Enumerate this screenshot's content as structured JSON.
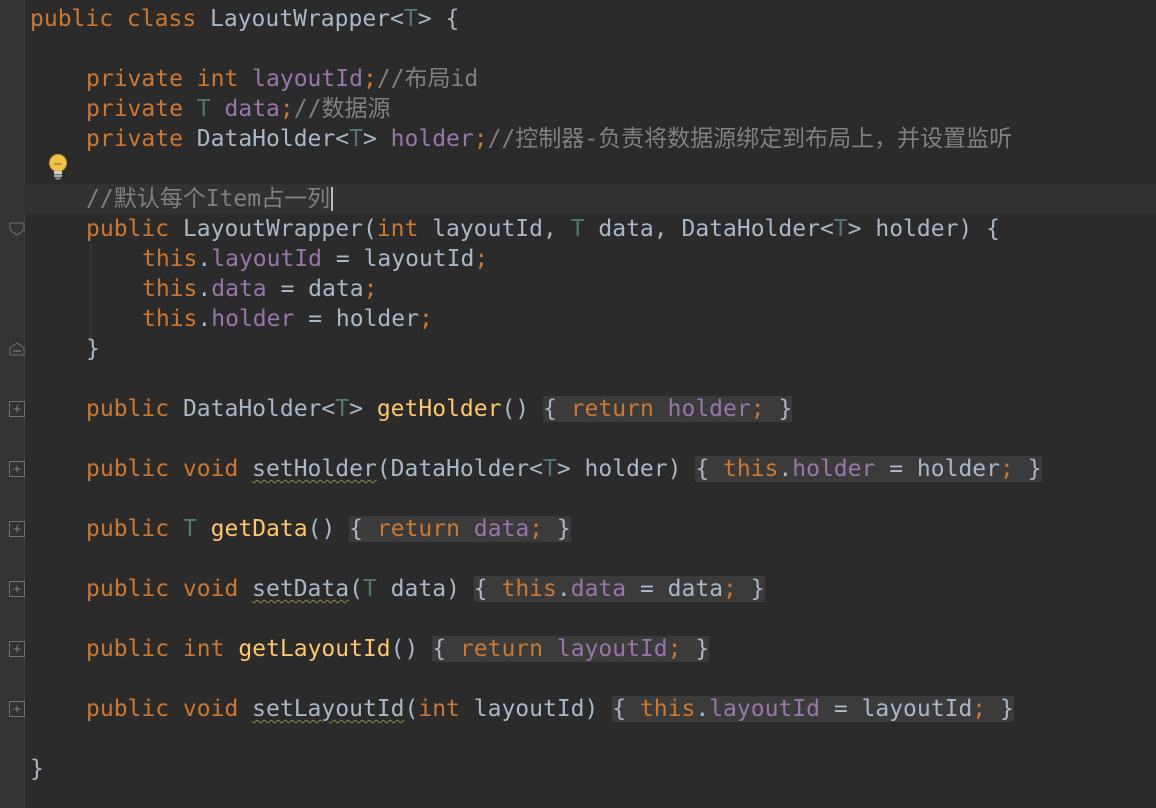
{
  "editor": {
    "theme_colors": {
      "background": "#2b2b2b",
      "keyword": "#cc7832",
      "field": "#9876aa",
      "type_param": "#507874",
      "method": "#ffc66d",
      "comment": "#808080",
      "text": "#a9b7c6"
    },
    "icons": {
      "intention_bulb": "lightbulb-icon",
      "fold_expand": "plus-box-icon",
      "fold_collapse": "minus-box-icon"
    }
  },
  "code": {
    "t": "T",
    "l1": {
      "kw": "public class ",
      "name": "LayoutWrapper<",
      "close": "> {"
    },
    "l2": {
      "kw": "private int ",
      "field": "layoutId",
      "semi": ";",
      "comment": "//布局id"
    },
    "l3": {
      "kw": "private ",
      "field": "data",
      "semi": ";",
      "comment": "//数据源"
    },
    "l4": {
      "kw": "private ",
      "type": "DataHolder<",
      "type_close": "> ",
      "field": "holder",
      "semi": ";",
      "comment": "//控制器-负责将数据源绑定到布局上，并设置监听"
    },
    "l6": {
      "comment": "//默认每个Item占一列"
    },
    "l7": {
      "kw1": "public ",
      "name": "LayoutWrapper(",
      "kw2": "int ",
      "p1": "layoutId, ",
      "p2": " data, DataHolder<",
      "p3": "> holder) {"
    },
    "l8": {
      "this": "this",
      "dot": ".",
      "field": "layoutId",
      "rest": " = layoutId",
      "semi": ";"
    },
    "l9": {
      "this": "this",
      "dot": ".",
      "field": "data",
      "rest": " = data",
      "semi": ";"
    },
    "l10": {
      "this": "this",
      "dot": ".",
      "field": "holder",
      "rest": " = holder",
      "semi": ";"
    },
    "l11": {
      "text": "}"
    },
    "l13": {
      "kw": "public ",
      "type": "DataHolder<",
      "type_close": "> ",
      "method": "getHolder",
      "parens": "() ",
      "fo": "{ ",
      "ret": "return ",
      "field": "holder",
      "semi": ";",
      "fc": " }"
    },
    "l15": {
      "kw": "public void ",
      "method": "setHolder",
      "params1": "(DataHolder<",
      "params2": "> holder) ",
      "fo": "{ ",
      "this": "this",
      "dot": ".",
      "field": "holder",
      "rest": " = holder",
      "semi": ";",
      "fc": " }"
    },
    "l17": {
      "kw": "public ",
      "type_space": " ",
      "method": "getData",
      "parens": "() ",
      "fo": "{ ",
      "ret": "return ",
      "field": "data",
      "semi": ";",
      "fc": " }"
    },
    "l19": {
      "kw": "public void ",
      "method": "setData",
      "params1": "(",
      "params2": " data) ",
      "fo": "{ ",
      "this": "this",
      "dot": ".",
      "field": "data",
      "rest": " = data",
      "semi": ";",
      "fc": " }"
    },
    "l21": {
      "kw": "public int ",
      "method": "getLayoutId",
      "parens": "() ",
      "fo": "{ ",
      "ret": "return ",
      "field": "layoutId",
      "semi": ";",
      "fc": " }"
    },
    "l23": {
      "kw": "public void ",
      "method": "setLayoutId",
      "params1": "(",
      "kw2": "int ",
      "params2": "layoutId) ",
      "fo": "{ ",
      "this": "this",
      "dot": ".",
      "field": "layoutId",
      "rest": " = layoutId",
      "semi": ";",
      "fc": " }"
    },
    "l25": {
      "text": "}"
    }
  }
}
